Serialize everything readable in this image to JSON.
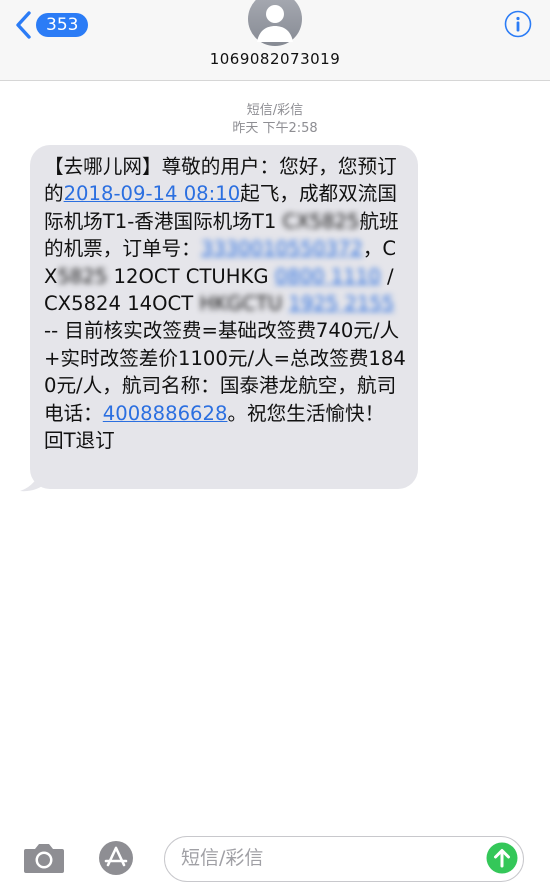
{
  "header": {
    "back_count": "353",
    "contact_number": "1069082073019"
  },
  "thread": {
    "meta_label": "短信/彩信",
    "timestamp": "昨天 下午2:58"
  },
  "message": {
    "brand": "【去哪儿网】",
    "greeting": "尊敬的用户：您好，",
    "line_a_prefix": "您预订的",
    "departure_time": "2018-09-14 08:10",
    "line_a_suffix": "起飞，",
    "route": "成都双流国际机场T1-香港国际机场T1 ",
    "flight_blurred": "CX5825",
    "flight_suffix": "航班的机票，订单号：",
    "order_no": "3330010550372",
    "seg1_sep": "，CX",
    "seg1_flight_blur": "5825",
    "seg1_date": " 12OCT",
    "seg1_route": "CTUHKG ",
    "seg1_ticket": "0800 1110",
    "seg2_sep": " / CX5824",
    "seg2_date": "14OCT ",
    "seg2_route_blur": "HKGCTU",
    "seg2_ticket": "1925 2155",
    "tail_text": " -- 目前核实改签费=基础改签费740元/人+实时改签差价1100元/人=总改签费1840元/人，航司名称：国泰港龙航空，航司电话：",
    "airline_phone": "4008886628",
    "closing": "。祝您生活愉快！ 回T退订"
  },
  "composer": {
    "placeholder": "短信/彩信"
  },
  "icons": {
    "back": "chevron-left-icon",
    "avatar": "person-avatar-icon",
    "info": "info-icon",
    "camera": "camera-icon",
    "apps": "app-store-icon",
    "send": "send-arrow-icon"
  },
  "colors": {
    "accent": "#2b7cf6",
    "bubble": "#e5e5ea",
    "send": "#34c759"
  }
}
